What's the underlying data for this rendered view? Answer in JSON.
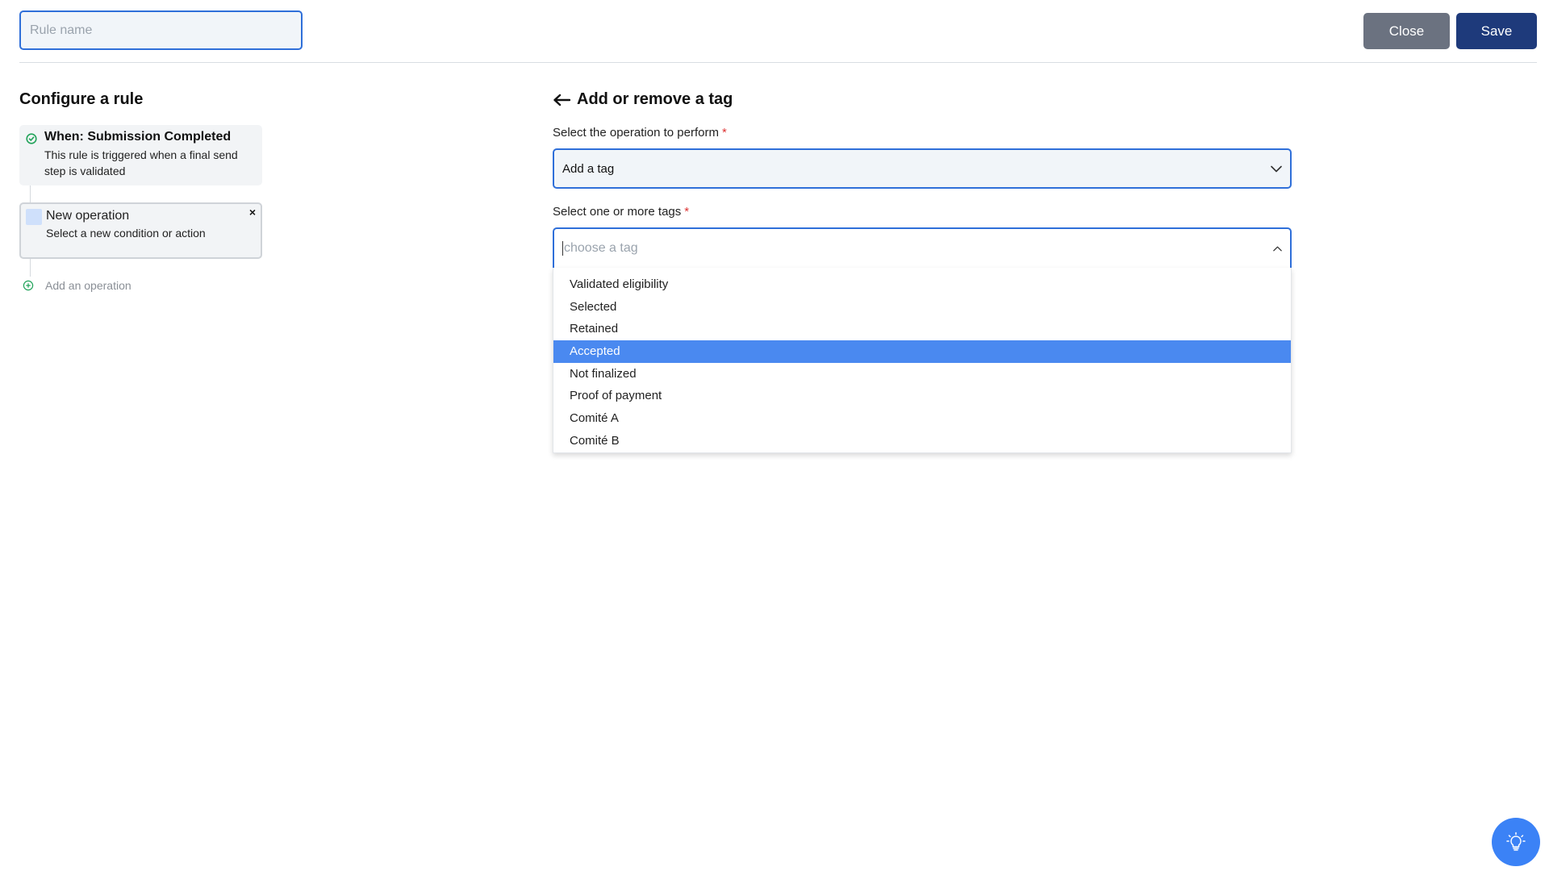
{
  "header": {
    "rule_name_placeholder": "Rule name",
    "close_label": "Close",
    "save_label": "Save"
  },
  "left": {
    "title": "Configure a rule",
    "trigger": {
      "title": "When: Submission Completed",
      "description": "This rule is triggered when a final send step is validated"
    },
    "operation": {
      "title": "New operation",
      "description": "Select a new condition or action",
      "close_glyph": "×"
    },
    "add_operation_label": "Add an operation"
  },
  "panel": {
    "title": "Add or remove a tag",
    "operation_label": "Select the operation to perform",
    "operation_value": "Add a tag",
    "tags_label": "Select one or more tags",
    "tags_placeholder": "choose a tag",
    "required_mark": "*",
    "options": [
      "Validated eligibility",
      "Selected",
      "Retained",
      "Accepted",
      "Not finalized",
      "Proof of payment",
      "Comité A",
      "Comité B"
    ],
    "highlighted_option": "Accepted"
  },
  "colors": {
    "primary": "#1e3a7b",
    "secondary": "#6b7280",
    "focus": "#2f6fd9",
    "highlight": "#4a89f0",
    "success": "#22a35a"
  },
  "icons": {
    "trigger": "check-circle-icon",
    "add_operation": "plus-circle-icon",
    "back": "arrow-left-icon",
    "select": "chevron-down-icon",
    "tags": "chevron-up-icon",
    "help": "lightbulb-icon"
  }
}
